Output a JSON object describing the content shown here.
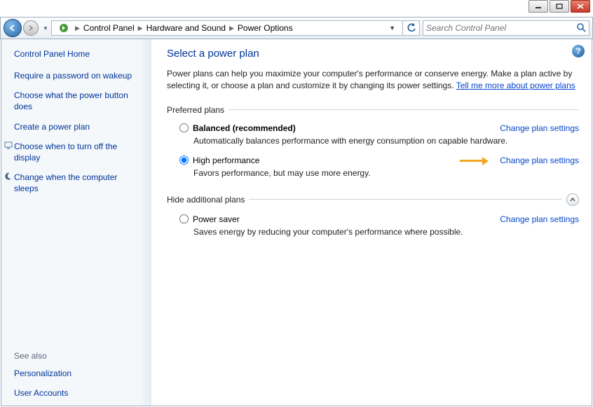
{
  "search_placeholder": "Search Control Panel",
  "breadcrumb": {
    "b0": "Control Panel",
    "b1": "Hardware and Sound",
    "b2": "Power Options"
  },
  "sidebar": {
    "home": "Control Panel Home",
    "l0": "Require a password on wakeup",
    "l1": "Choose what the power button does",
    "l2": "Create a power plan",
    "l3": "Choose when to turn off the display",
    "l4": "Change when the computer sleeps",
    "see_also": "See also",
    "s0": "Personalization",
    "s1": "User Accounts"
  },
  "content": {
    "title": "Select a power plan",
    "intro1": "Power plans can help you maximize your computer's performance or conserve energy. Make a plan active by selecting it, or choose a plan and customize it by changing its power settings. ",
    "intro_link": "Tell me more about power plans",
    "sec_preferred": "Preferred plans",
    "sec_hide": "Hide additional plans",
    "change_link": "Change plan settings",
    "plan0_name": "Balanced (recommended)",
    "plan0_desc": "Automatically balances performance with energy consumption on capable hardware.",
    "plan1_name": "High performance",
    "plan1_desc": "Favors performance, but may use more energy.",
    "plan2_name": "Power saver",
    "plan2_desc": "Saves energy by reducing your computer's performance where possible."
  }
}
